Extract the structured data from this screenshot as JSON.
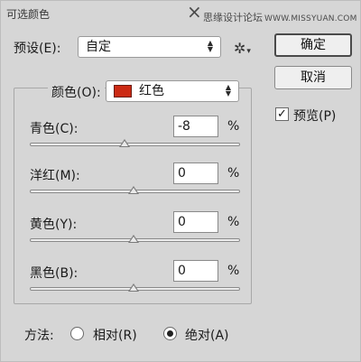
{
  "window": {
    "title": "可选颜色",
    "watermark_cn": "思缘设计论坛",
    "watermark_url": "WWW.MISSYUAN.COM"
  },
  "preset": {
    "label": "预设(E):",
    "value": "自定"
  },
  "buttons": {
    "ok": "确定",
    "cancel": "取消"
  },
  "preview": {
    "label": "预览(P)",
    "checked": true,
    "check_glyph": "✓"
  },
  "colors": {
    "label": "颜色(O):",
    "value": "红色",
    "swatch_color": "#cc2a14"
  },
  "sliders": [
    {
      "label": "青色(C):",
      "value": "-8",
      "unit": "%",
      "percent": -8
    },
    {
      "label": "洋红(M):",
      "value": "0",
      "unit": "%",
      "percent": 0
    },
    {
      "label": "黄色(Y):",
      "value": "0",
      "unit": "%",
      "percent": 0
    },
    {
      "label": "黑色(B):",
      "value": "0",
      "unit": "%",
      "percent": 0
    }
  ],
  "method": {
    "label": "方法:",
    "options": [
      {
        "label": "相对(R)",
        "selected": false
      },
      {
        "label": "绝对(A)",
        "selected": true
      }
    ]
  },
  "icons": {
    "close": "×",
    "gear": "✲",
    "chevron": "▾",
    "arrow_up": "▲",
    "arrow_down": "▼"
  }
}
